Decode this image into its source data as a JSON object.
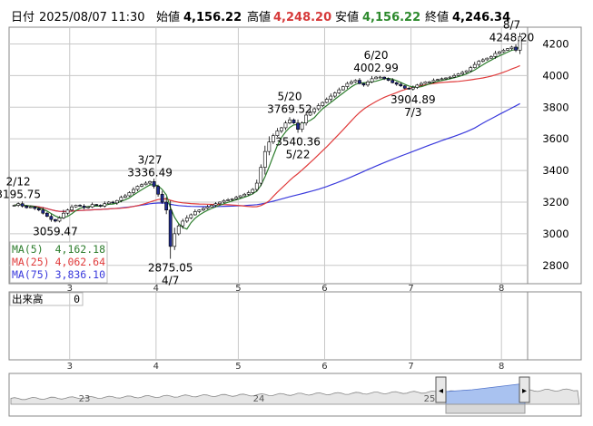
{
  "header": {
    "date_label": "日付",
    "date_value": "2025/08/07 11:30",
    "open_label": "始値",
    "open_value": "4,156.22",
    "high_label": "高値",
    "high_value": "4,248.20",
    "low_label": "安値",
    "low_value": "4,156.22",
    "close_label": "終値",
    "close_value": "4,246.34"
  },
  "legend": [
    {
      "label": "MA(5)",
      "value": "4,162.18",
      "color": "#2d7d2d"
    },
    {
      "label": "MA(25)",
      "value": "4,062.64",
      "color": "#e03c3c"
    },
    {
      "label": "MA(75)",
      "value": "3,836.10",
      "color": "#3a3adc"
    }
  ],
  "volume": {
    "label": "出来高",
    "value": "0"
  },
  "nav": {
    "start_label": "23",
    "mid_label": "24",
    "end_label": "25",
    "left_button": "◂",
    "right_button": "▸"
  },
  "colors": {
    "up": "#ffffff",
    "down": "#1f2a8c",
    "grid": "#c8c8c8",
    "nav_fill": "#a9c2f0"
  },
  "chart_data": {
    "type": "candlestick",
    "x_tick_labels": [
      "3",
      "4",
      "5",
      "6",
      "7",
      "8"
    ],
    "y_ticks": [
      2800,
      3000,
      3200,
      3400,
      3600,
      3800,
      4000,
      4200
    ],
    "ylim": [
      2690,
      4300
    ],
    "annotations": [
      {
        "text_date": "2/12",
        "text_value": "3195.75",
        "kind": "high",
        "index": 1
      },
      {
        "text_date": "3/27",
        "text_value": "3336.49",
        "kind": "high",
        "index": 33
      },
      {
        "text_date": "4/7",
        "text_value": "2875.05",
        "kind": "low",
        "index": 38
      },
      {
        "text_value": "3059.47",
        "kind": "low",
        "index": 10
      },
      {
        "text_date": "5/20",
        "text_value": "3769.52",
        "kind": "high",
        "index": 67
      },
      {
        "text_date": "5/22",
        "text_value": "3540.36",
        "kind": "low",
        "index": 69
      },
      {
        "text_date": "6/20",
        "text_value": "4002.99",
        "kind": "high",
        "index": 88
      },
      {
        "text_date": "7/3",
        "text_value": "3904.89",
        "kind": "low",
        "index": 97
      },
      {
        "text_date": "8/7",
        "text_value": "4248.20",
        "kind": "high",
        "index": 121
      }
    ],
    "month_start_index": [
      0,
      14,
      35,
      55,
      76,
      97,
      119
    ],
    "closes": [
      3180,
      3190,
      3175,
      3165,
      3170,
      3160,
      3150,
      3130,
      3110,
      3090,
      3080,
      3100,
      3130,
      3150,
      3170,
      3180,
      3175,
      3165,
      3170,
      3185,
      3180,
      3175,
      3190,
      3200,
      3195,
      3210,
      3230,
      3240,
      3260,
      3280,
      3300,
      3310,
      3320,
      3330,
      3300,
      3250,
      3200,
      3150,
      2920,
      3000,
      3050,
      3080,
      3100,
      3120,
      3140,
      3150,
      3160,
      3170,
      3180,
      3190,
      3200,
      3210,
      3215,
      3220,
      3230,
      3240,
      3250,
      3260,
      3280,
      3320,
      3420,
      3520,
      3580,
      3620,
      3650,
      3670,
      3700,
      3720,
      3700,
      3660,
      3700,
      3750,
      3770,
      3790,
      3810,
      3830,
      3850,
      3870,
      3890,
      3910,
      3930,
      3950,
      3960,
      3970,
      3950,
      3940,
      3960,
      3980,
      3990,
      3990,
      3980,
      3970,
      3955,
      3945,
      3935,
      3920,
      3915,
      3925,
      3940,
      3950,
      3960,
      3960,
      3970,
      3975,
      3980,
      3985,
      3990,
      4000,
      4010,
      4020,
      4030,
      4050,
      4070,
      4090,
      4100,
      4110,
      4120,
      4140,
      4150,
      4160,
      4170,
      4180,
      4160,
      4246
    ]
  }
}
